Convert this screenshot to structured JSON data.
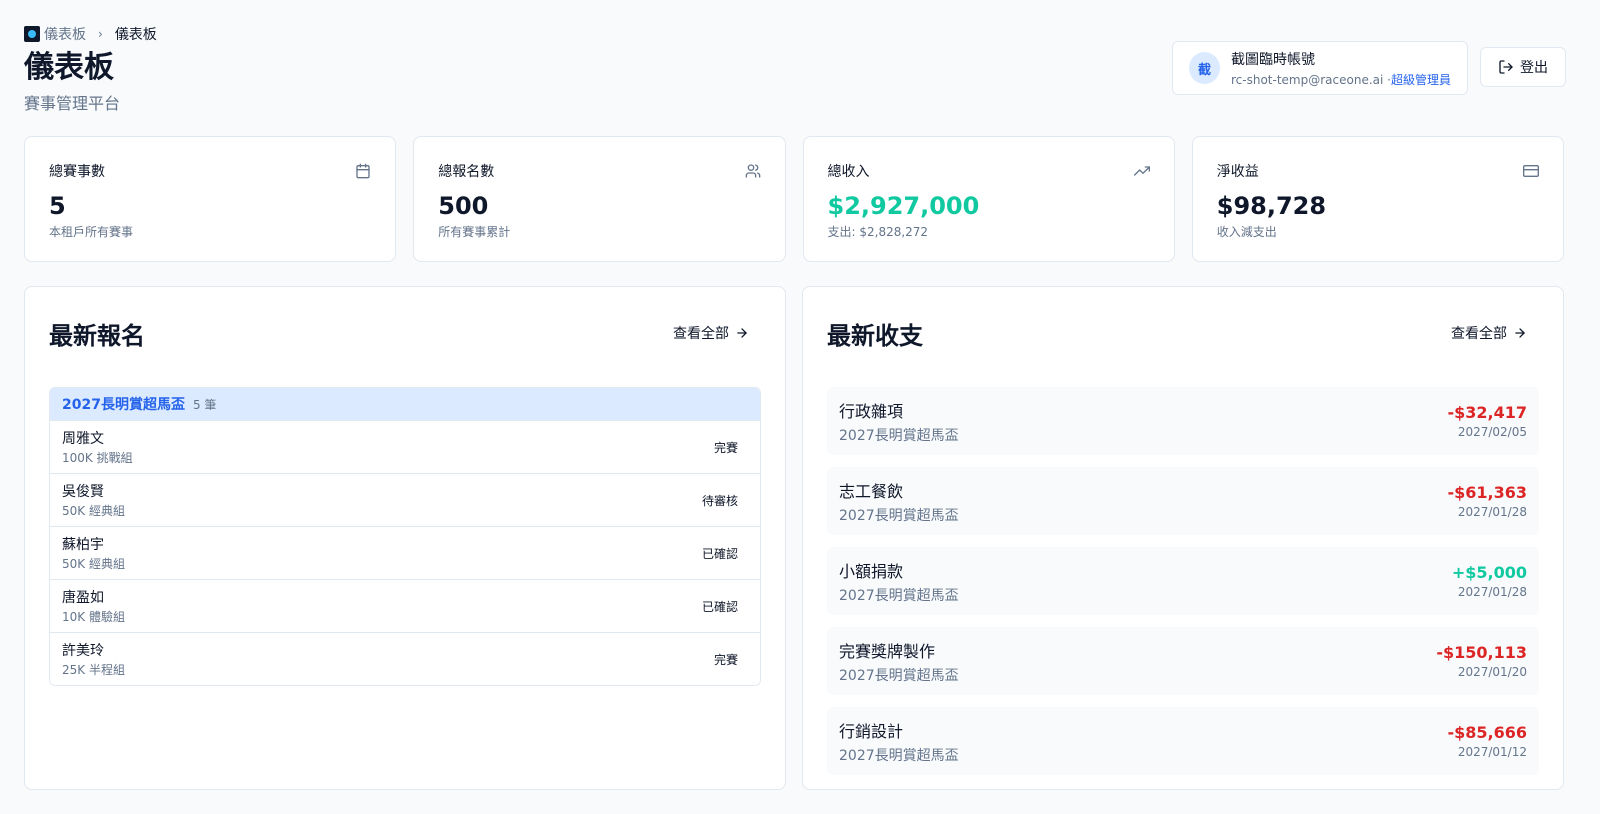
{
  "breadcrumb": {
    "root": "儀表板",
    "current": "儀表板"
  },
  "page": {
    "title": "儀表板",
    "subtitle": "賽事管理平台"
  },
  "user": {
    "avatar": "截",
    "name": "截圖臨時帳號",
    "email": "rc-shot-temp@raceone.ai",
    "sep": "·",
    "role": "超級管理員"
  },
  "logout_label": "登出",
  "stats": [
    {
      "label": "總賽事數",
      "value": "5",
      "note": "本租戶所有賽事",
      "icon": "calendar-icon"
    },
    {
      "label": "總報名數",
      "value": "500",
      "note": "所有賽事累計",
      "icon": "users-icon"
    },
    {
      "label": "總收入",
      "value": "$2,927,000",
      "note": "支出: $2,828,272",
      "icon": "trending-up-icon"
    },
    {
      "label": "淨收益",
      "value": "$98,728",
      "note": "收入減支出",
      "icon": "credit-card-icon"
    }
  ],
  "registrations": {
    "title": "最新報名",
    "view_all": "查看全部",
    "group": {
      "event": "2027長明賞超馬盃",
      "count": "5 筆"
    },
    "rows": [
      {
        "name": "周雅文",
        "category": "100K 挑戰組",
        "status": "完賽"
      },
      {
        "name": "吳俊賢",
        "category": "50K 經典組",
        "status": "待審核"
      },
      {
        "name": "蘇柏宇",
        "category": "50K 經典組",
        "status": "已確認"
      },
      {
        "name": "唐盈如",
        "category": "10K 體驗組",
        "status": "已確認"
      },
      {
        "name": "許美玲",
        "category": "25K 半程組",
        "status": "完賽"
      }
    ]
  },
  "transactions": {
    "title": "最新收支",
    "view_all": "查看全部",
    "items": [
      {
        "title": "行政雜項",
        "event": "2027長明賞超馬盃",
        "amount": "-$32,417",
        "date": "2027/02/05"
      },
      {
        "title": "志工餐飲",
        "event": "2027長明賞超馬盃",
        "amount": "-$61,363",
        "date": "2027/01/28"
      },
      {
        "title": "小額捐款",
        "event": "2027長明賞超馬盃",
        "amount": "+$5,000",
        "date": "2027/01/28"
      },
      {
        "title": "完賽獎牌製作",
        "event": "2027長明賞超馬盃",
        "amount": "-$150,113",
        "date": "2027/01/20"
      },
      {
        "title": "行銷設計",
        "event": "2027長明賞超馬盃",
        "amount": "-$85,666",
        "date": "2027/01/12"
      }
    ]
  },
  "colors": {
    "accent": "#2563eb",
    "positive": "#10c9a0",
    "negative": "#dc2626"
  }
}
